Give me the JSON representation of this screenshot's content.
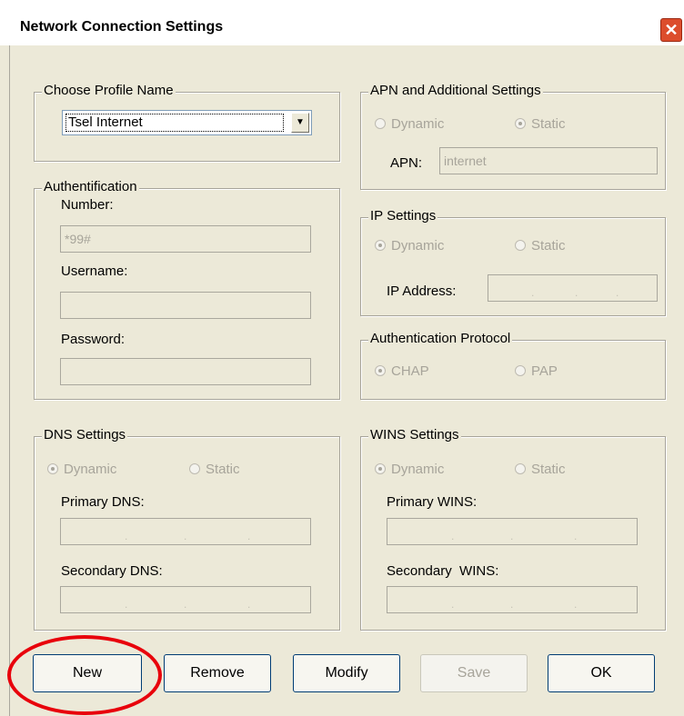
{
  "window": {
    "title": "Network Connection Settings",
    "close_glyph": "✕"
  },
  "profile": {
    "legend": "Choose Profile Name",
    "selected": "Tsel Internet"
  },
  "auth": {
    "legend": "Authentification",
    "number_label": "Number:",
    "number_value": "*99#",
    "username_label": "Username:",
    "username_value": "",
    "password_label": "Password:",
    "password_value": ""
  },
  "apn": {
    "legend": "APN and Additional Settings",
    "dynamic": "Dynamic",
    "static": "Static",
    "selected": "static",
    "apn_label": "APN:",
    "apn_value": "internet"
  },
  "ip": {
    "legend": "IP Settings",
    "dynamic": "Dynamic",
    "static": "Static",
    "selected": "dynamic",
    "address_label": "IP Address:"
  },
  "auth_protocol": {
    "legend": "Authentication Protocol",
    "chap": "CHAP",
    "pap": "PAP",
    "selected": "chap"
  },
  "dns": {
    "legend": "DNS Settings",
    "dynamic": "Dynamic",
    "static": "Static",
    "selected": "dynamic",
    "primary_label": "Primary DNS:",
    "secondary_label": "Secondary DNS:"
  },
  "wins": {
    "legend": "WINS Settings",
    "dynamic": "Dynamic",
    "static": "Static",
    "selected": "dynamic",
    "primary_label": "Primary WINS:",
    "secondary_label": "Secondary  WINS:"
  },
  "buttons": {
    "new": "New",
    "remove": "Remove",
    "modify": "Modify",
    "save": "Save",
    "ok": "OK"
  },
  "colors": {
    "highlight_circle": "#e8000b",
    "close_button": "#dc4d2c"
  }
}
